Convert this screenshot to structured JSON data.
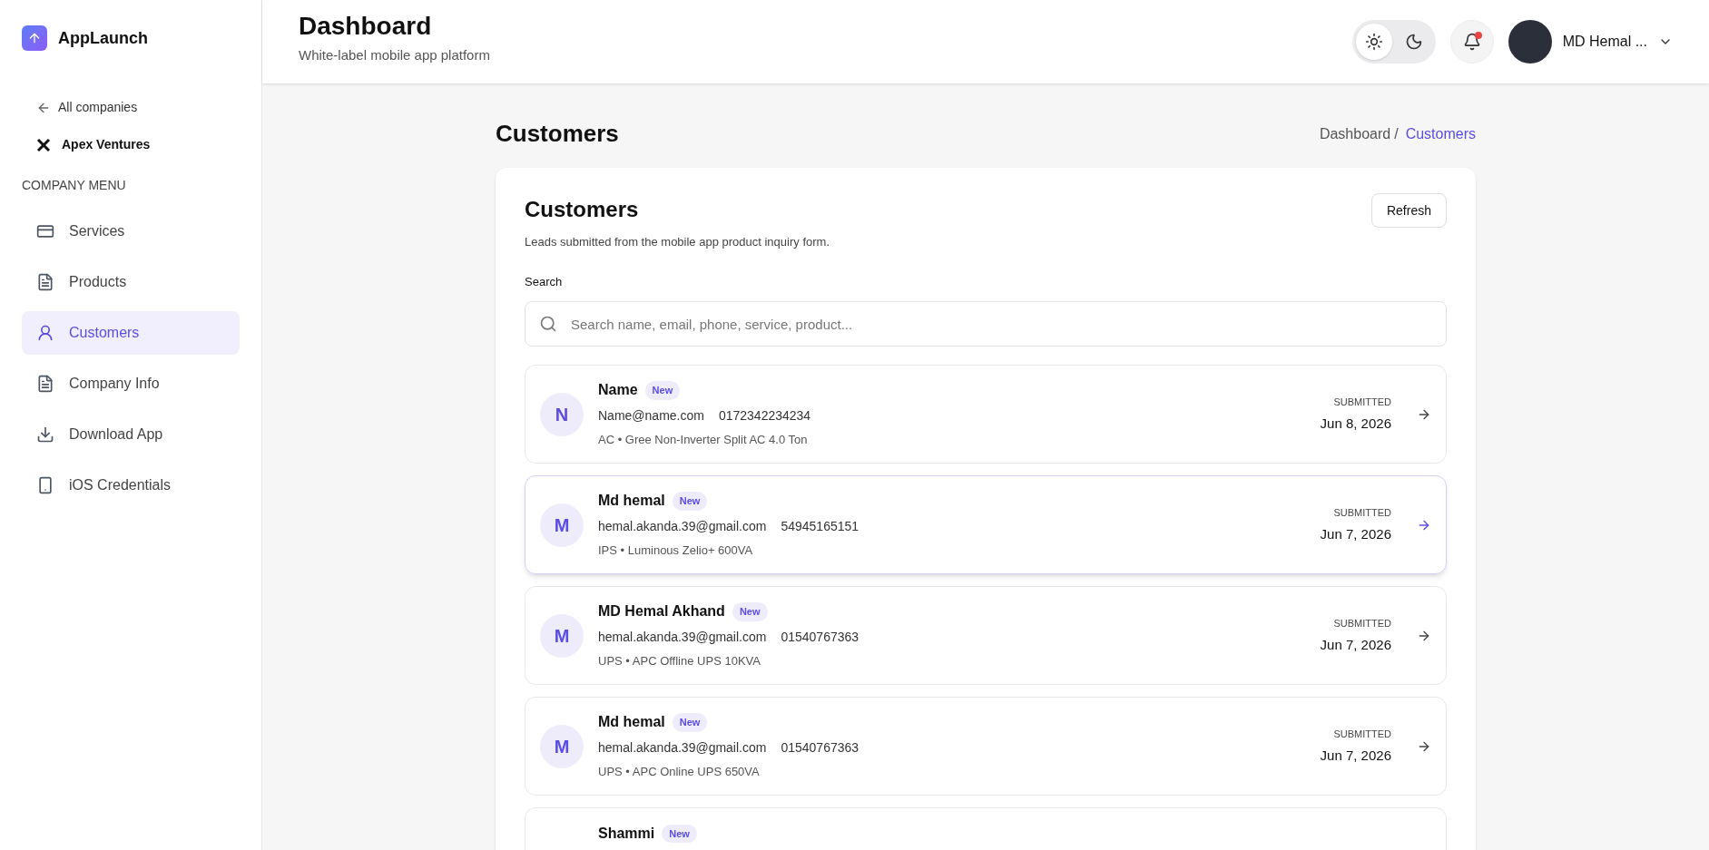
{
  "brand": {
    "name": "AppLaunch"
  },
  "sidebar": {
    "back_link": "All companies",
    "company": "Apex Ventures",
    "section_title": "COMPANY MENU",
    "items": [
      {
        "label": "Services",
        "selected": false
      },
      {
        "label": "Products",
        "selected": false
      },
      {
        "label": "Customers",
        "selected": true
      },
      {
        "label": "Company Info",
        "selected": false
      },
      {
        "label": "Download App",
        "selected": false
      },
      {
        "label": "iOS Credentials",
        "selected": false
      }
    ]
  },
  "header": {
    "title": "Dashboard",
    "subtitle": "White-label mobile app platform",
    "theme": [
      {
        "selected": true
      },
      {
        "selected": false
      }
    ],
    "notifications_unread": true,
    "user_name": "MD Hemal ..."
  },
  "page": {
    "title": "Customers",
    "breadcrumb_separator": "/",
    "breadcrumb": [
      {
        "label": "Dashboard",
        "selected": false
      },
      {
        "label": "Customers",
        "selected": true
      }
    ]
  },
  "card": {
    "title": "Customers",
    "description": "Leads submitted from the mobile app product inquiry form.",
    "refresh_button": "Refresh",
    "search_label": "Search",
    "search_placeholder": "Search name, email, phone, service, product...",
    "rows": [
      {
        "initial": "N",
        "name": "Name",
        "badge": "New",
        "email": "Name@name.com",
        "phone": "0172342234234",
        "product": "AC • Gree Non-Inverter Split AC 4.0 Ton",
        "submitted_label": "SUBMITTED",
        "date": "Jun 8, 2026",
        "hovered": false
      },
      {
        "initial": "M",
        "name": "Md hemal",
        "badge": "New",
        "email": "hemal.akanda.39@gmail.com",
        "phone": "54945165151",
        "product": "IPS • Luminous Zelio+ 600VA",
        "submitted_label": "SUBMITTED",
        "date": "Jun 7, 2026",
        "hovered": true
      },
      {
        "initial": "M",
        "name": "MD Hemal Akhand",
        "badge": "New",
        "email": "hemal.akanda.39@gmail.com",
        "phone": "01540767363",
        "product": "UPS • APC Offline UPS 10KVA",
        "submitted_label": "SUBMITTED",
        "date": "Jun 7, 2026",
        "hovered": false
      },
      {
        "initial": "M",
        "name": "Md hemal",
        "badge": "New",
        "email": "hemal.akanda.39@gmail.com",
        "phone": "01540767363",
        "product": "UPS • APC Online UPS 650VA",
        "submitted_label": "SUBMITTED",
        "date": "Jun 7, 2026",
        "hovered": false
      },
      {
        "name": "Shammi",
        "badge": "New",
        "hovered": false
      }
    ]
  }
}
